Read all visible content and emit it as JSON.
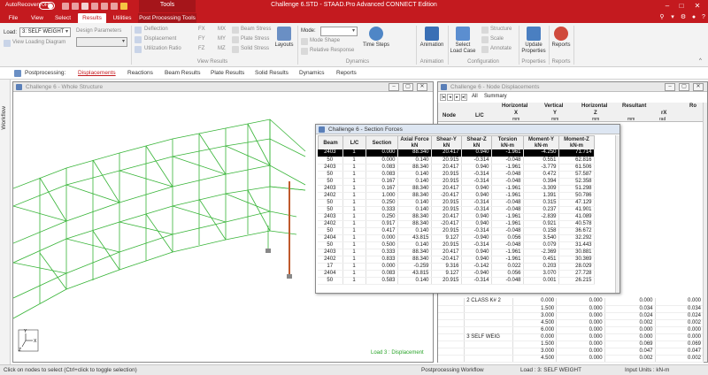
{
  "titlebar": {
    "autorecovery": "AutoRecovery",
    "toggle": "OFF",
    "context_tab": "Tools",
    "title": "Challenge 6.STD - STAAD.Pro Advanced CONNECT Edition"
  },
  "tabs": [
    "File",
    "View",
    "Select",
    "Results",
    "Utilities"
  ],
  "context_tab_label": "Post Processing Tools",
  "ribbon": {
    "load_label": "Load:",
    "load_value": "3: SELF WEIGHT",
    "view_loading": "View Loading Diagram",
    "design_params": "Design Parameters",
    "view_results": [
      "Deflection",
      "Displacement",
      "Utilization Ratio"
    ],
    "forces": [
      "FX",
      "FY",
      "FZ",
      "MX",
      "MY",
      "MZ"
    ],
    "stresses": [
      "Beam Stress",
      "Plate Stress",
      "Solid Stress"
    ],
    "layouts": "Layouts",
    "mode_label": "Mode:",
    "mode_shape": "Mode Shape",
    "relative_response": "Relative Response",
    "time_steps": "Time Steps",
    "animation": "Animation",
    "select_load_case": "Select Load Case",
    "structure": "Structure",
    "scale": "Scale",
    "annotate": "Annotate",
    "update_properties": "Update Properties",
    "reports": "Reports",
    "groups": {
      "view_results": "View Results",
      "dynamics": "Dynamics",
      "animation": "Animation",
      "configuration": "Configuration",
      "properties": "Properties",
      "reports": "Reports"
    }
  },
  "nav": {
    "label": "Postprocessing:",
    "items": [
      "Displacements",
      "Reactions",
      "Beam Results",
      "Plate Results",
      "Solid Results",
      "Dynamics",
      "Reports"
    ]
  },
  "workflow": "Workflow",
  "structure_window": {
    "title": "Challenge 6 - Whole Structure",
    "load_label": "Load 3 : Displacement"
  },
  "node_window": {
    "title": "Challenge 6 - Node Displacements",
    "tabs": [
      "All",
      "Summary"
    ],
    "headers": {
      "node": "Node",
      "lc": "L/C",
      "horizontal_x": "Horizontal",
      "vertical_y": "Vertical",
      "horizontal_z": "Horizontal",
      "resultant": "Resultant",
      "rx": "rX",
      "rc": "Ro"
    },
    "sub": {
      "x": "X",
      "y": "Y",
      "z": "Z",
      "rad": "rad",
      "mm": "mm"
    },
    "rows": [
      [
        "",
        "2 CLASS K# 2",
        "0.000",
        "0.000",
        "0.000",
        "0.000"
      ],
      [
        "",
        "",
        "1.500",
        "0.000",
        "0.034",
        "0.034"
      ],
      [
        "",
        "",
        "3.000",
        "0.000",
        "0.024",
        "0.024"
      ],
      [
        "",
        "",
        "4.500",
        "0.000",
        "0.002",
        "0.002"
      ],
      [
        "",
        "",
        "6.000",
        "0.000",
        "0.000",
        "0.000"
      ],
      [
        "",
        "3 SELF WEIG",
        "0.000",
        "0.000",
        "0.000",
        "0.000"
      ],
      [
        "",
        "",
        "1.500",
        "0.000",
        "0.069",
        "0.069"
      ],
      [
        "",
        "",
        "3.000",
        "0.000",
        "0.047",
        "0.047"
      ],
      [
        "",
        "",
        "4.500",
        "0.000",
        "0.002",
        "0.002"
      ]
    ]
  },
  "section_window": {
    "title": "Challenge 6 - Section Forces",
    "headers": [
      "Beam",
      "L/C",
      "Section",
      "Axial Force",
      "Shear-Y",
      "Shear-Z",
      "Torsion",
      "Moment-Y",
      "Moment-Z"
    ],
    "units": [
      "",
      "",
      "",
      "kN",
      "kN",
      "kN",
      "kN-m",
      "kN-m",
      "kN-m"
    ],
    "rows": [
      [
        "2403",
        "1",
        "0.000",
        "88.340",
        "20.417",
        "0.940",
        "-1.961",
        "-4.250",
        "71.714"
      ],
      [
        "50",
        "1",
        "0.000",
        "0.140",
        "20.915",
        "-0.314",
        "-0.048",
        "0.551",
        "62.816"
      ],
      [
        "2403",
        "1",
        "0.083",
        "88.340",
        "20.417",
        "0.940",
        "-1.961",
        "-3.779",
        "61.506"
      ],
      [
        "50",
        "1",
        "0.083",
        "0.140",
        "20.915",
        "-0.314",
        "-0.048",
        "0.472",
        "57.587"
      ],
      [
        "50",
        "1",
        "0.167",
        "0.140",
        "20.915",
        "-0.314",
        "-0.048",
        "0.394",
        "52.358"
      ],
      [
        "2403",
        "1",
        "0.167",
        "88.340",
        "20.417",
        "0.940",
        "-1.961",
        "-3.309",
        "51.298"
      ],
      [
        "2402",
        "1",
        "1.000",
        "88.340",
        "-20.417",
        "0.940",
        "-1.961",
        "1.391",
        "50.786"
      ],
      [
        "50",
        "1",
        "0.250",
        "0.140",
        "20.915",
        "-0.314",
        "-0.048",
        "0.315",
        "47.129"
      ],
      [
        "50",
        "1",
        "0.333",
        "0.140",
        "20.915",
        "-0.314",
        "-0.048",
        "0.237",
        "41.901"
      ],
      [
        "2403",
        "1",
        "0.250",
        "88.340",
        "20.417",
        "0.940",
        "-1.961",
        "-2.839",
        "41.089"
      ],
      [
        "2402",
        "1",
        "0.917",
        "88.340",
        "-20.417",
        "0.940",
        "-1.961",
        "0.921",
        "40.578"
      ],
      [
        "50",
        "1",
        "0.417",
        "0.140",
        "20.915",
        "-0.314",
        "-0.048",
        "0.158",
        "36.672"
      ],
      [
        "2404",
        "1",
        "0.000",
        "43.815",
        "9.127",
        "-0.940",
        "0.056",
        "3.540",
        "32.292"
      ],
      [
        "50",
        "1",
        "0.500",
        "0.140",
        "20.915",
        "-0.314",
        "-0.048",
        "0.079",
        "31.443"
      ],
      [
        "2403",
        "1",
        "0.333",
        "88.340",
        "20.417",
        "0.940",
        "-1.961",
        "-2.369",
        "30.881"
      ],
      [
        "2402",
        "1",
        "0.833",
        "88.340",
        "-20.417",
        "0.940",
        "-1.961",
        "0.451",
        "30.369"
      ],
      [
        "17",
        "1",
        "0.000",
        "-0.259",
        "9.316",
        "-0.142",
        "0.022",
        "0.203",
        "28.029"
      ],
      [
        "2404",
        "1",
        "0.083",
        "43.815",
        "9.127",
        "-0.940",
        "0.056",
        "3.070",
        "27.728"
      ],
      [
        "50",
        "1",
        "0.583",
        "0.140",
        "20.915",
        "-0.314",
        "-0.048",
        "0.001",
        "26.215"
      ]
    ]
  },
  "status": {
    "hint": "Click on nodes to select (Ctrl+click to toggle selection)",
    "workflow": "Postprocessing Workflow",
    "load": "Load : 3: SELF WEIGHT",
    "units": "Input Units : kN-m"
  }
}
